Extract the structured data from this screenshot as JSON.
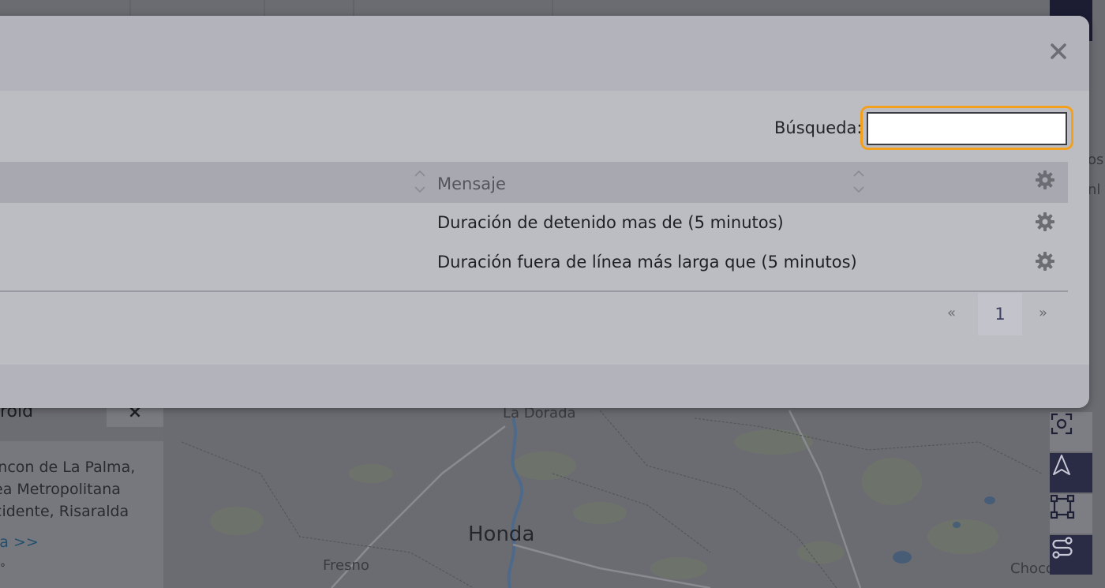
{
  "map": {
    "labels": {
      "la_dorada": "La Dorada",
      "honda": "Honda",
      "fresno": "Fresno",
      "choco": "Choco",
      "edge1": "os",
      "edge2": "nl"
    },
    "info_popup": {
      "title": "droid",
      "close": "×",
      "line1": "incon de La Palma,",
      "line2": "ea Metropolitana",
      "line3": "cidente, Risaralda",
      "link": "ia >>",
      "mini": "°"
    },
    "tools": [
      "focus-icon",
      "navigation-icon",
      "rectangle-select-icon",
      "route-icon"
    ]
  },
  "modal": {
    "search": {
      "label": "Búsqueda:",
      "value": "",
      "placeholder": ""
    },
    "table": {
      "columns": [
        "",
        "Mensaje"
      ],
      "rows": [
        {
          "mensaje": "Duración de detenido mas de (5 minutos)"
        },
        {
          "mensaje": "Duración fuera de línea más larga que (5 minutos)"
        }
      ]
    },
    "pagination": {
      "prev": "«",
      "current": "1",
      "next": "»"
    }
  },
  "colors": {
    "focus_outline": "#f3a01d",
    "modal_bg": "#b6b7be",
    "toolbar_dark": "#2a2b44"
  }
}
